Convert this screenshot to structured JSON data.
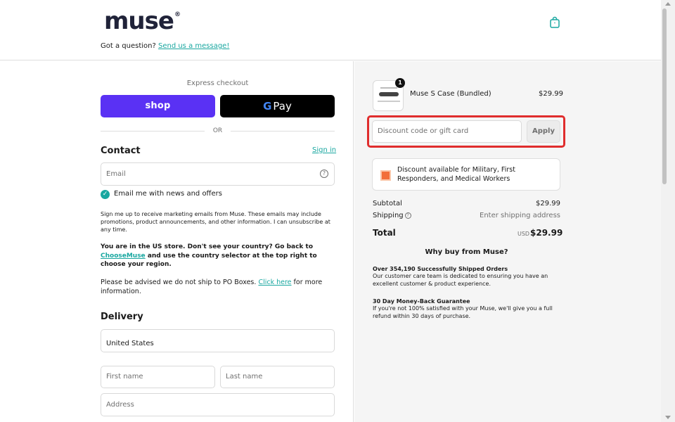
{
  "header": {
    "logo": "muse",
    "logo_mark": "®",
    "question_text": "Got a question?",
    "message_link": "Send us a message!",
    "cart_icon": "shopping-bag-icon"
  },
  "express": {
    "label": "Express checkout",
    "shop_label": "shop",
    "gpay_g": "G",
    "gpay_label": "Pay",
    "or_label": "OR"
  },
  "contact": {
    "title": "Contact",
    "signin": "Sign in",
    "email_placeholder": "Email",
    "help_icon": "question-circle-icon",
    "newsletter_label": "Email me with news and offers",
    "newsletter_checked": true,
    "consent_text": "Sign me up to receive marketing emails from Muse. These emails may include promotions, product announcements, and other information. I can unsubscribe at any time.",
    "store_notice_1": "You are in the US store. Don't see your country? Go back to",
    "store_notice_link": "ChooseMuse",
    "store_notice_2": "and use the country selector at the top right to choose your region.",
    "po_notice_1": "Please be advised we do not ship to PO Boxes.",
    "po_notice_link": "Click here",
    "po_notice_2": "for more information."
  },
  "delivery": {
    "title": "Delivery",
    "country_value": "United States",
    "first_name_placeholder": "First name",
    "last_name_placeholder": "Last name",
    "address_placeholder": "Address"
  },
  "summary": {
    "item": {
      "name": "Muse S Case (Bundled)",
      "price": "$29.99",
      "quantity": "1"
    },
    "discount_placeholder": "Discount code or gift card",
    "apply_label": "Apply",
    "promo_text": "Discount available for Military, First Responders, and Medical Workers",
    "subtotal_label": "Subtotal",
    "subtotal_value": "$29.99",
    "shipping_label": "Shipping",
    "shipping_value": "Enter shipping address",
    "total_label": "Total",
    "total_currency": "USD",
    "total_value": "$29.99",
    "why_title": "Why buy from Muse?",
    "reasons": [
      {
        "title": "Over 354,190 Successfully Shipped Orders",
        "text": "Our customer care team is dedicated to ensuring you have an excellent customer & product experience."
      },
      {
        "title": "30 Day Money-Back Guarantee",
        "text": "If you're not 100% satisfied with your Muse, we'll give you a full refund within 30 days of purchase."
      }
    ]
  },
  "colors": {
    "accent": "#19a7a0",
    "shop_purple": "#5a31f4",
    "highlight_red": "#e02d2d"
  }
}
